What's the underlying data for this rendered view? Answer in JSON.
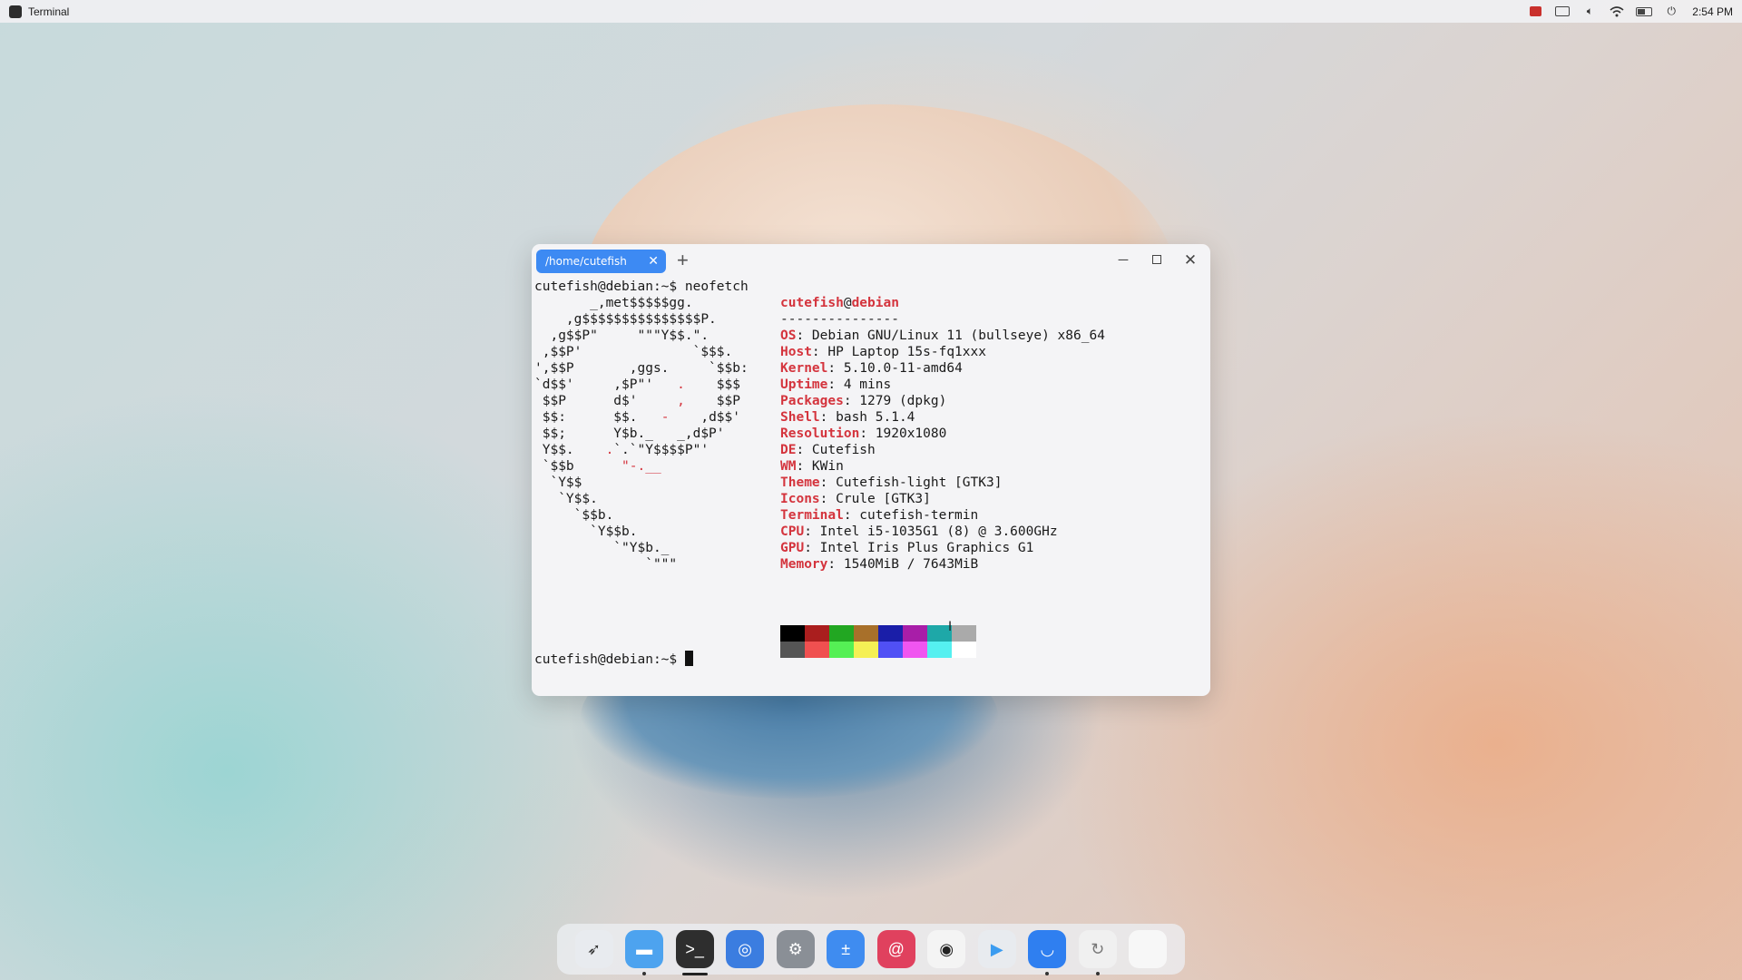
{
  "topbar": {
    "app_name": "Terminal",
    "tray_icons": [
      "flag-icon",
      "keyboard-icon",
      "volume-icon",
      "wifi-icon",
      "battery-icon",
      "power-icon"
    ],
    "clock": "2:54 PM"
  },
  "terminal": {
    "tab_label": "/home/cutefish",
    "tab_close": "✕",
    "new_tab": "+",
    "minimize": "─",
    "close": "✕",
    "command_line": "cutefish@debian:~$ neofetch",
    "ascii_art": [
      [
        [
          "       _,met$$$$$gg.",
          ""
        ]
      ],
      [
        [
          "    ,g$$$$$$$$$$$$$$$P.",
          ""
        ]
      ],
      [
        [
          "  ,g$$P\"     \"\"\"Y$$.\".",
          ""
        ]
      ],
      [
        [
          " ,$$P'              `$$$.",
          ""
        ]
      ],
      [
        [
          "',$$P       ,ggs.     `$$b:",
          ""
        ]
      ],
      [
        [
          "`d$$'     ,$P\"'   ",
          ""
        ],
        [
          ".",
          "r"
        ],
        [
          "    $$$",
          ""
        ]
      ],
      [
        [
          " $$P      d$'     ",
          ""
        ],
        [
          ",",
          "r"
        ],
        [
          "    $$P",
          ""
        ]
      ],
      [
        [
          " $$:      $$.   ",
          ""
        ],
        [
          "-",
          "r"
        ],
        [
          "    ,d$$'",
          ""
        ]
      ],
      [
        [
          " $$;      Y$b._   _,d$P'",
          ""
        ]
      ],
      [
        [
          " Y$$.    ",
          ""
        ],
        [
          ".",
          "r"
        ],
        [
          "`.",
          ""
        ],
        [
          "`\"Y$$$$P\"'",
          ""
        ]
      ],
      [
        [
          " `$$b      ",
          ""
        ],
        [
          "\"-.__",
          "r"
        ]
      ],
      [
        [
          "  `Y$$",
          ""
        ]
      ],
      [
        [
          "   `Y$$.",
          ""
        ]
      ],
      [
        [
          "     `$$b.",
          ""
        ]
      ],
      [
        [
          "       `Y$$b.",
          ""
        ]
      ],
      [
        [
          "          `\"Y$b._",
          ""
        ]
      ],
      [
        [
          "              `\"\"\"",
          ""
        ]
      ]
    ],
    "user": "cutefish",
    "at": "@",
    "host": "debian",
    "separator": "---------------",
    "info": [
      {
        "key": "OS",
        "value": ": Debian GNU/Linux 11 (bullseye) x86_64"
      },
      {
        "key": "Host",
        "value": ": HP Laptop 15s-fq1xxx"
      },
      {
        "key": "Kernel",
        "value": ": 5.10.0-11-amd64"
      },
      {
        "key": "Uptime",
        "value": ": 4 mins"
      },
      {
        "key": "Packages",
        "value": ": 1279 (dpkg)"
      },
      {
        "key": "Shell",
        "value": ": bash 5.1.4"
      },
      {
        "key": "Resolution",
        "value": ": 1920x1080"
      },
      {
        "key": "DE",
        "value": ": Cutefish"
      },
      {
        "key": "WM",
        "value": ": KWin"
      },
      {
        "key": "Theme",
        "value": ": Cutefish-light [GTK3]"
      },
      {
        "key": "Icons",
        "value": ": Crule [GTK3]"
      },
      {
        "key": "Terminal",
        "value": ": cutefish-termin"
      },
      {
        "key": "CPU",
        "value": ": Intel i5-1035G1 (8) @ 3.600GHz"
      },
      {
        "key": "GPU",
        "value": ": Intel Iris Plus Graphics G1"
      },
      {
        "key": "Memory",
        "value": ": 1540MiB / 7643MiB"
      }
    ],
    "palette": [
      "#000000",
      "#aa1e1e",
      "#22a722",
      "#a8702a",
      "#1a1ea8",
      "#a81ea8",
      "#1ea8a8",
      "#aaaaaa",
      "#555555",
      "#f05050",
      "#55f055",
      "#f5f055",
      "#5050f5",
      "#f055f0",
      "#55f0f0",
      "#ffffff"
    ],
    "prompt": "cutefish@debian:~$ ",
    "cursor_glyph": "I"
  },
  "dock": {
    "items": [
      {
        "name": "launcher-icon",
        "color": "#e8ebef",
        "fg": "#333",
        "glyph": "➶",
        "running": false
      },
      {
        "name": "file-manager-icon",
        "color": "#4da3ef",
        "fg": "#ffffff",
        "glyph": "▬",
        "running": true
      },
      {
        "name": "terminal-icon",
        "color": "#2e2e2e",
        "fg": "#ffffff",
        "glyph": ">_",
        "running": "active"
      },
      {
        "name": "browser-icon",
        "color": "#3b7de0",
        "fg": "#ffffff",
        "glyph": "◎",
        "running": false
      },
      {
        "name": "settings-icon",
        "color": "#8a8f96",
        "fg": "#ffffff",
        "glyph": "⚙",
        "running": false
      },
      {
        "name": "calculator-icon",
        "color": "#3f8cf0",
        "fg": "#ffffff",
        "glyph": "±",
        "running": false
      },
      {
        "name": "debian-icon",
        "color": "#e0415e",
        "fg": "#ffffff",
        "glyph": "@",
        "running": false
      },
      {
        "name": "screenshot-icon",
        "color": "#f4f4f4",
        "fg": "#222",
        "glyph": "◉",
        "running": false
      },
      {
        "name": "video-player-icon",
        "color": "#e8ebef",
        "fg": "#3b9cf0",
        "glyph": "▶",
        "running": false
      },
      {
        "name": "app-store-icon",
        "color": "#2f7ff0",
        "fg": "#ffffff",
        "glyph": "◡",
        "running": true
      },
      {
        "name": "software-update-icon",
        "color": "#f0f0f0",
        "fg": "#777",
        "glyph": "↻",
        "running": true
      },
      {
        "name": "trash-icon",
        "color": "#f7f7f7",
        "fg": "#bbb",
        "glyph": "",
        "running": false
      }
    ]
  }
}
